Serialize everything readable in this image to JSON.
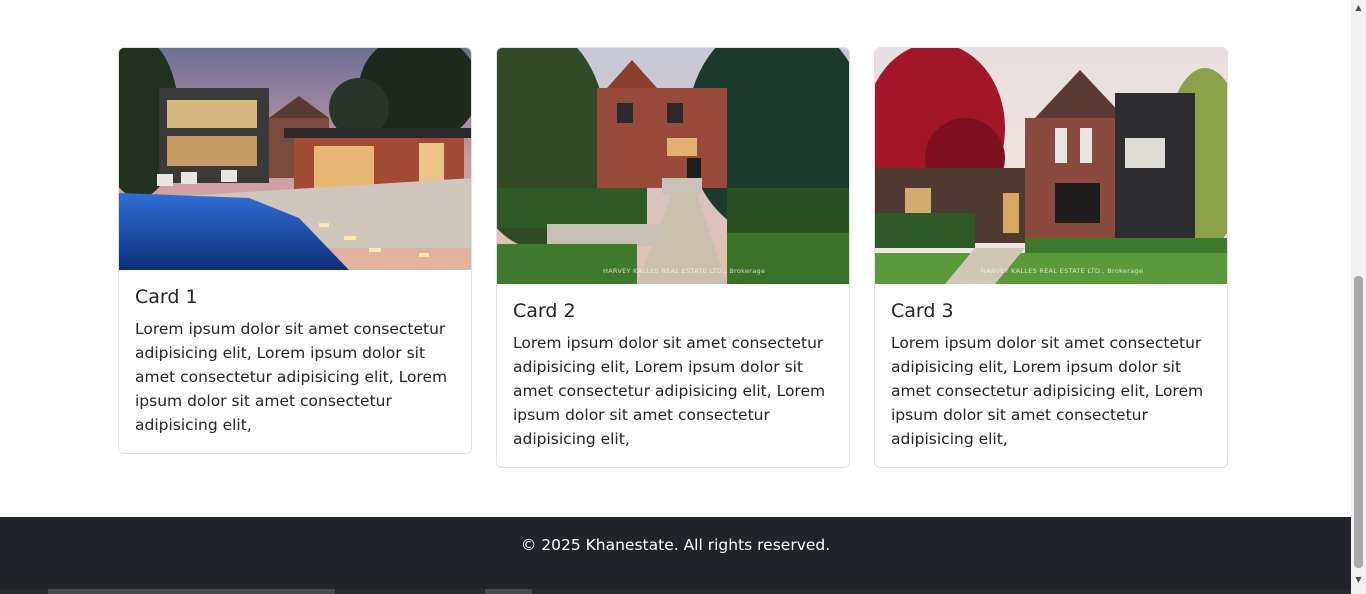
{
  "cards": [
    {
      "title": "Card 1",
      "text": "Lorem ipsum dolor sit amet consectetur adipisicing elit, Lorem ipsum dolor sit amet consectetur adipisicing elit, Lorem ipsum dolor sit amet consectetur adipisicing elit,"
    },
    {
      "title": "Card 2",
      "text": "Lorem ipsum dolor sit amet consectetur adipisicing elit, Lorem ipsum dolor sit amet consectetur adipisicing elit, Lorem ipsum dolor sit amet consectetur adipisicing elit,",
      "watermark": "HARVEY KALLES REAL ESTATE LTD., Brokerage"
    },
    {
      "title": "Card 3",
      "text": "Lorem ipsum dolor sit amet consectetur adipisicing elit, Lorem ipsum dolor sit amet consectetur adipisicing elit, Lorem ipsum dolor sit amet consectetur adipisicing elit,",
      "watermark": "HARVEY KALLES REAL ESTATE LTD., Brokerage"
    }
  ],
  "footer": {
    "copyright": "© 2025 Khanestate. All rights reserved."
  },
  "colors": {
    "footer_bg": "#212529",
    "card_border": "#dee2e6"
  }
}
